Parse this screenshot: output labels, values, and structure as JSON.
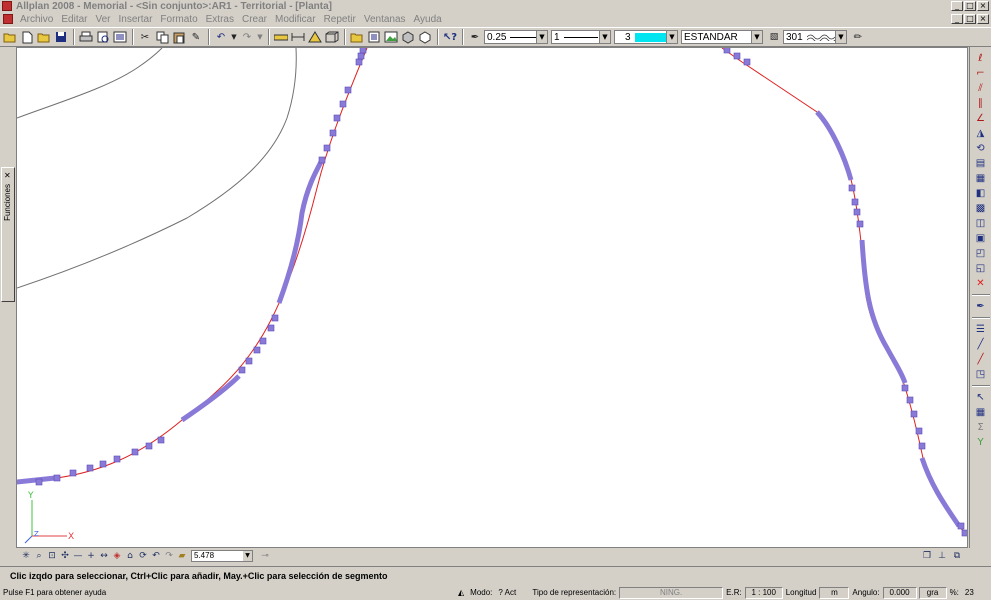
{
  "window": {
    "title": "Allplan 2008 - Memorial - <Sin conjunto>:AR1 - Territorial - [Planta]",
    "controls": {
      "minimize": "_",
      "maximize": "□",
      "close": "×"
    }
  },
  "menu": [
    "Archivo",
    "Editar",
    "Ver",
    "Insertar",
    "Formato",
    "Extras",
    "Crear",
    "Modificar",
    "Repetir",
    "Ventanas",
    "Ayuda"
  ],
  "toolbar": {
    "pen_thickness": "0.25",
    "line_type": "1",
    "color_number": "3",
    "layer": "ESTANDAR",
    "pattern": "301",
    "colors": {
      "swatch": "#00e5f0"
    }
  },
  "left_panel": {
    "tab_label": "Funciones"
  },
  "viewbar": {
    "zoom_value": "5.478"
  },
  "prompt": {
    "text": "Clic izqdo para seleccionar, Ctrl+Clic para añadir, May.+Clic para selección de segmento"
  },
  "status": {
    "help": "Pulse F1 para obtener ayuda",
    "modo_label": "Modo:",
    "modo_value": "? Act",
    "rep_label": "Tipo de representación:",
    "rep_value": "NING.",
    "scale_label": "E.R:",
    "scale_value": "1 : 100",
    "length_label": "Longitud",
    "length_unit": "m",
    "angle_label": "Angulo:",
    "angle_value": "0.000",
    "angle_unit": "gra",
    "percent_label": "%:",
    "percent_value": "23"
  },
  "axes": {
    "y_label": "Y",
    "x_label": "X",
    "z_label": "Z"
  },
  "colors": {
    "selection": "#8a7ad8",
    "selection_edge": "#5a4ab8",
    "polyline": "#e02020",
    "contour": "#707070"
  }
}
